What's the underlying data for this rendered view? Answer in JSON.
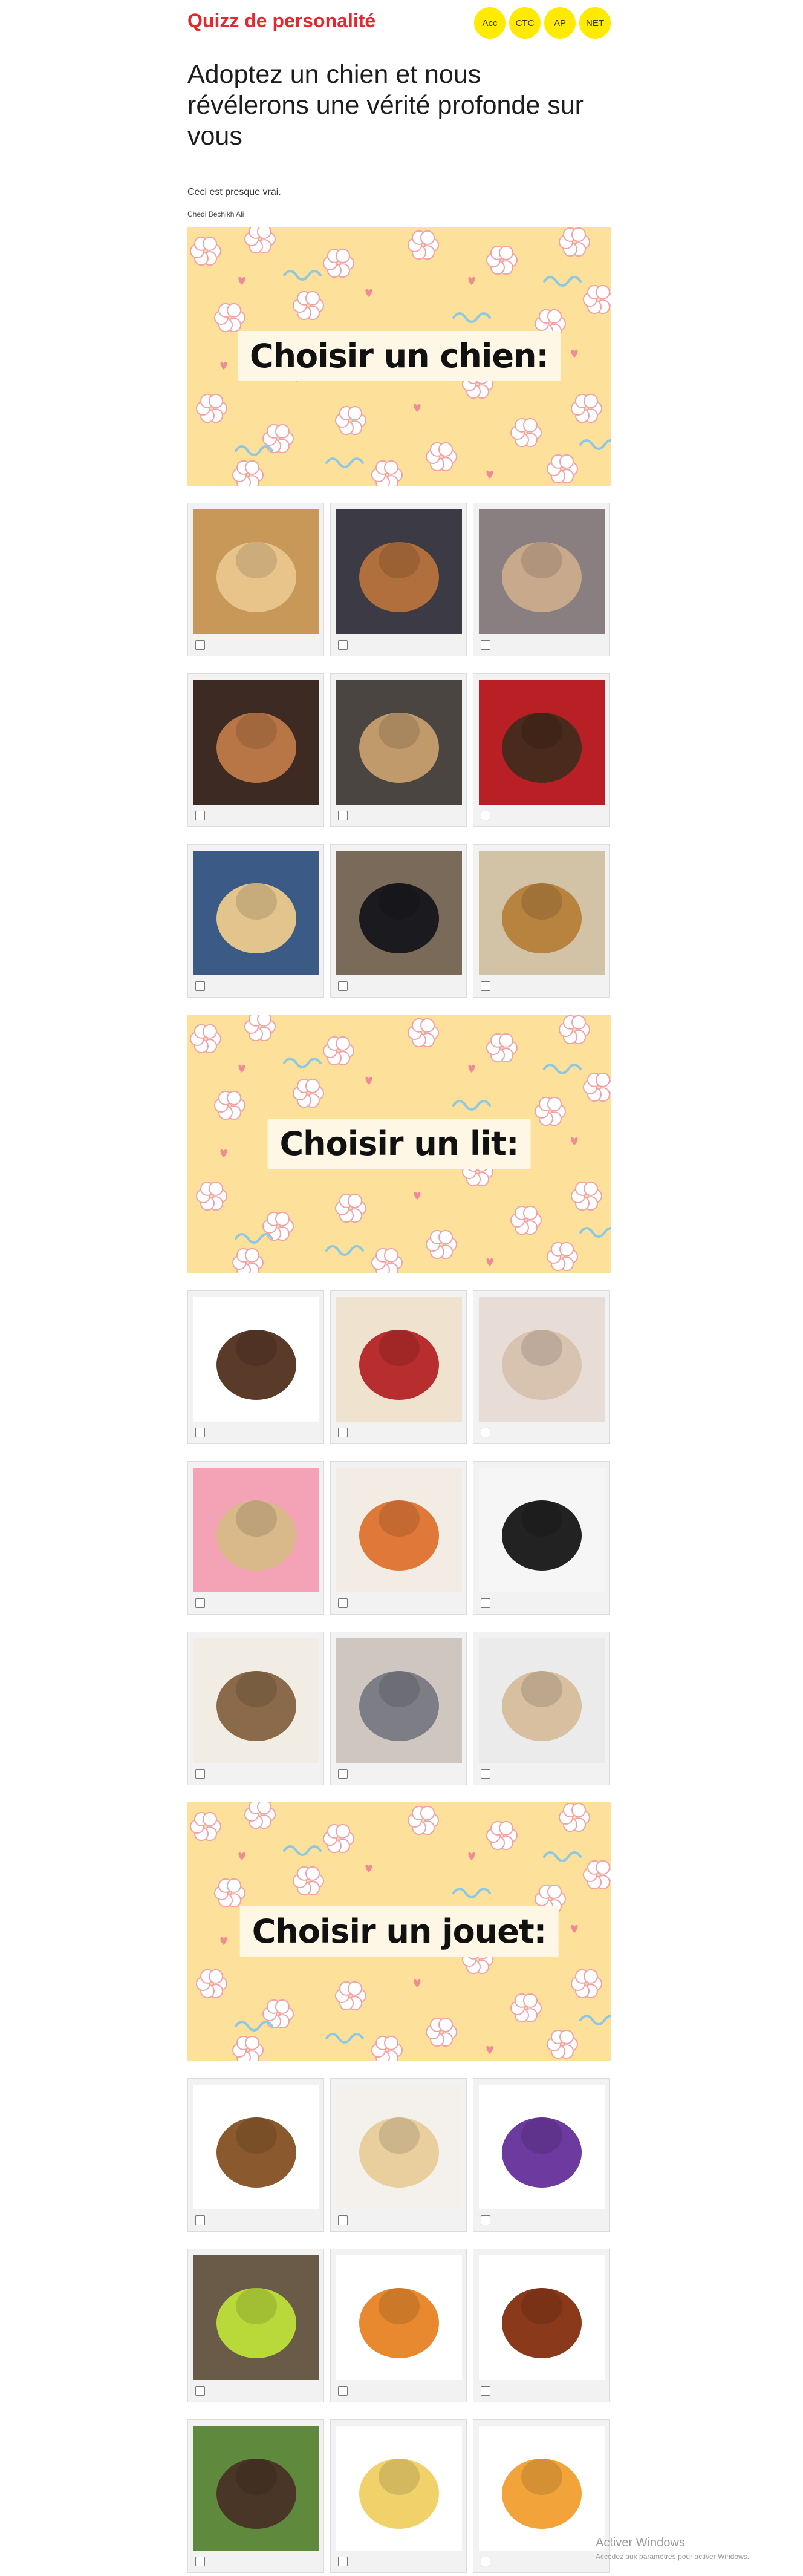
{
  "header": {
    "brand": "Quizz de personalité",
    "nav": [
      "Acc",
      "CTC",
      "AP",
      "NET"
    ]
  },
  "article": {
    "title": "Adoptez un chien et nous révélerons une vérité profonde sur vous",
    "subtitle": "Ceci est presque vrai.",
    "author": "Chedi Bechikh Ali"
  },
  "sections": [
    {
      "banner": "Choisir un chien:",
      "items": [
        {
          "icon": "golden-puppy-photo",
          "bg": "#c79858",
          "fg": "#e8c48b"
        },
        {
          "icon": "brown-dog-photo",
          "bg": "#3b3a45",
          "fg": "#b06f3d"
        },
        {
          "icon": "sleeping-puppy-photo",
          "bg": "#8a7f80",
          "fg": "#c9a98c"
        },
        {
          "icon": "smiling-dog-photo",
          "bg": "#3d2a22",
          "fg": "#b87646"
        },
        {
          "icon": "dog-with-toy-photo",
          "bg": "#4a4540",
          "fg": "#c19a6b"
        },
        {
          "icon": "puppy-in-cart-photo",
          "bg": "#b82025",
          "fg": "#4a2a1c"
        },
        {
          "icon": "dog-with-glasses-photo",
          "bg": "#3c5a86",
          "fg": "#e2c48c"
        },
        {
          "icon": "black-labrador-photo",
          "bg": "#7a6a5a",
          "fg": "#1a1a1f"
        },
        {
          "icon": "lying-puppy-photo",
          "bg": "#d2c3a6",
          "fg": "#b8823f"
        }
      ]
    },
    {
      "banner": "Choisir un lit:",
      "items": [
        {
          "icon": "round-dog-bed-photo",
          "bg": "#ffffff",
          "fg": "#5a3a28"
        },
        {
          "icon": "dog-on-bed-photo",
          "bg": "#efe3cf",
          "fg": "#b82d2d"
        },
        {
          "icon": "dog-on-pillow-photo",
          "bg": "#e8ddd6",
          "fg": "#d8c2b0"
        },
        {
          "icon": "wicker-basket-bed-photo",
          "bg": "#f4a3b6",
          "fg": "#d9b98a"
        },
        {
          "icon": "burger-dog-bed-photo",
          "bg": "#f3ece5",
          "fg": "#e0783a"
        },
        {
          "icon": "teepee-dog-bed-photo",
          "bg": "#f6f6f6",
          "fg": "#222222"
        },
        {
          "icon": "canopy-dog-bed-photo",
          "bg": "#f2ede4",
          "fg": "#8a6a4a"
        },
        {
          "icon": "totoro-dog-bed-photo",
          "bg": "#cfc6c0",
          "fg": "#7d7d86"
        },
        {
          "icon": "raised-wooden-bed-photo",
          "bg": "#ebebeb",
          "fg": "#d7bfa0"
        }
      ]
    },
    {
      "banner": "Choisir un jouet:",
      "items": [
        {
          "icon": "moose-plush-toy-photo",
          "bg": "#ffffff",
          "fg": "#8a5a2e"
        },
        {
          "icon": "puppy-with-shoe-photo",
          "bg": "#f4f1ec",
          "fg": "#e9cf9e"
        },
        {
          "icon": "tennis-ball-toy-photo",
          "bg": "#ffffff",
          "fg": "#6d3aa0"
        },
        {
          "icon": "dog-with-big-ball-photo",
          "bg": "#6a5a48",
          "fg": "#b9d93b"
        },
        {
          "icon": "burger-toy-photo",
          "bg": "#ffffff",
          "fg": "#e8892f"
        },
        {
          "icon": "pretzel-toy-photo",
          "bg": "#ffffff",
          "fg": "#8a3a1a"
        },
        {
          "icon": "two-dogs-running-photo",
          "bg": "#5f8a3e",
          "fg": "#4a3626"
        },
        {
          "icon": "duck-plush-toy-photo",
          "bg": "#ffffff",
          "fg": "#f1d26a"
        },
        {
          "icon": "taco-toy-photo",
          "bg": "#ffffff",
          "fg": "#f2a43a"
        }
      ]
    }
  ],
  "watermark": {
    "line1": "Activer Windows",
    "line2": "Accédez aux paramètres pour activer Windows."
  }
}
